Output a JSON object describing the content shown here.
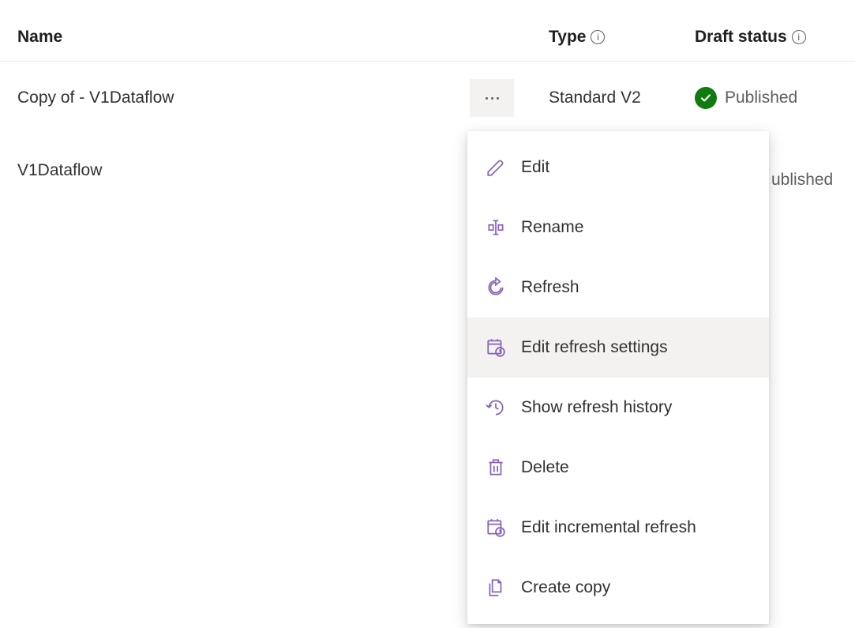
{
  "headers": {
    "name": "Name",
    "type": "Type",
    "draft_status": "Draft status"
  },
  "rows": [
    {
      "name": "Copy of - V1Dataflow",
      "type": "Standard V2",
      "status": "Published"
    },
    {
      "name": "V1Dataflow",
      "type": "",
      "status_fragment": "ublished"
    }
  ],
  "context_menu": {
    "items": [
      {
        "label": "Edit"
      },
      {
        "label": "Rename"
      },
      {
        "label": "Refresh"
      },
      {
        "label": "Edit refresh settings"
      },
      {
        "label": "Show refresh history"
      },
      {
        "label": "Delete"
      },
      {
        "label": "Edit incremental refresh"
      },
      {
        "label": "Create copy"
      }
    ],
    "hovered_index": 3
  }
}
